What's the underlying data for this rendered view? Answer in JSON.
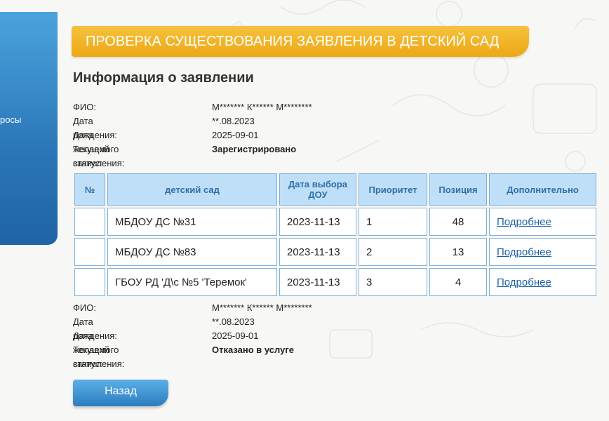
{
  "sidebar": {
    "item_partial": "росы"
  },
  "banner": {
    "title": "ПРОВЕРКА СУЩЕСТВОВАНИЯ ЗАЯВЛЕНИЯ В ДЕТСКИЙ САД"
  },
  "section": {
    "title": "Информация о заявлении"
  },
  "info1": {
    "fio_label": "ФИО:",
    "fio_value": "М******* К****** М********",
    "birth_label": "Дата рождения:",
    "birth_value": "**.08.2023",
    "enroll_label": "Дата желаемого зачисления:",
    "enroll_value": "2025-09-01",
    "status_label": "Текущий статус:",
    "status_value": "Зарегистрировано"
  },
  "table": {
    "headers": [
      "№",
      "детский сад",
      "Дата выбора ДОУ",
      "Приоритет",
      "Позиция",
      "Дополнительно"
    ],
    "rows": [
      {
        "num": "",
        "garden": "МБДОУ ДС №31",
        "date": "2023-11-13",
        "priority": "1",
        "position": "48",
        "more": "Подробнее"
      },
      {
        "num": "",
        "garden": "МБДОУ ДС №83",
        "date": "2023-11-13",
        "priority": "2",
        "position": "13",
        "more": "Подробнее"
      },
      {
        "num": "",
        "garden": "ГБОУ РД 'Д\\с №5 'Теремок'",
        "date": "2023-11-13",
        "priority": "3",
        "position": "4",
        "more": "Подробнее"
      }
    ]
  },
  "info2": {
    "fio_label": "ФИО:",
    "fio_value": "М******* К****** М********",
    "birth_label": "Дата рождения:",
    "birth_value": "**.08.2023",
    "enroll_label": "Дата желаемого зачисления:",
    "enroll_value": "2025-09-01",
    "status_label": "Текущий статус:",
    "status_value": "Отказано в услуге"
  },
  "back_button": {
    "label": "Назад"
  },
  "colors": {
    "banner": "#f0b020",
    "accent_blue": "#2d7cc0",
    "table_header": "#bfdff8"
  }
}
